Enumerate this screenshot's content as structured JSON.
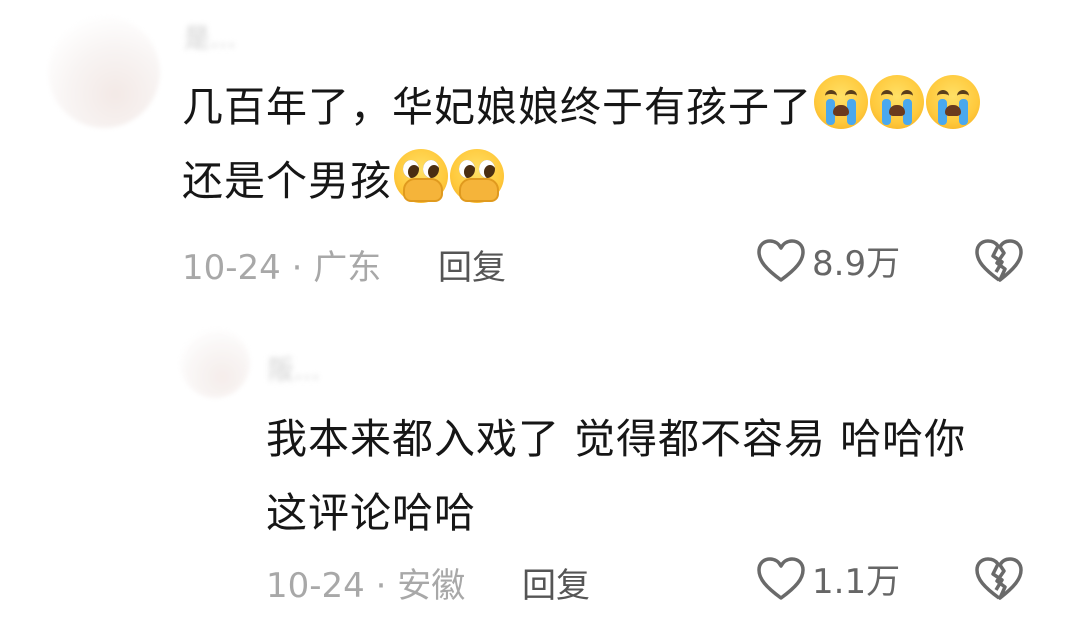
{
  "comments": [
    {
      "username": "是…",
      "lines": [
        "几百年了，华妃娘娘终于有孩子了",
        "还是个男孩"
      ],
      "line_emojis": [
        [
          "loudly-crying-face",
          "loudly-crying-face",
          "loudly-crying-face"
        ],
        [
          "face-holding-back-tears",
          "face-holding-back-tears"
        ]
      ],
      "meta": "10-24 · 广东",
      "reply_label": "回复",
      "like_count": "8.9万"
    },
    {
      "username": "阪…",
      "lines": [
        "我本来都入戏了 觉得都不容易 哈哈你",
        "这评论哈哈"
      ],
      "meta": "10-24 · 安徽",
      "reply_label": "回复",
      "like_count": "1.1万"
    }
  ],
  "colors": {
    "text": "#161616",
    "meta": "#a8a8a8",
    "reply": "#555555",
    "icon": "#6a6a6a"
  }
}
